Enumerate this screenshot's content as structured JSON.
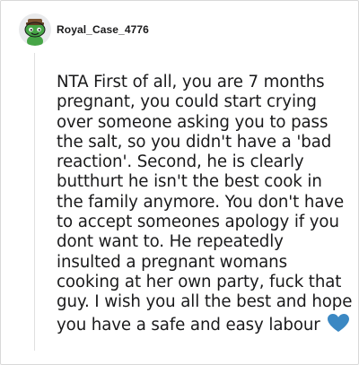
{
  "comment": {
    "author": "Royal_Case_4776",
    "avatar_icon": "reddit-snoo-avatar-icon",
    "body": "NTA First of all, you are 7 months pregnant, you could start crying over someone asking you to pass the salt, so you didn't have a 'bad reaction'. Second, he is clearly butthurt he isn't the best cook in the family anymore. You don't have to accept someones apology if you dont want to. He repeatedly insulted a pregnant womans cooking at her own party, fuck that guy. I wish you all the best and hope you have a safe and easy labour",
    "emoji_icon": "blue-heart-icon"
  },
  "colors": {
    "text": "#1a1a1b",
    "heart": "#3b88c3",
    "avatar_green": "#46a546",
    "avatar_bg": "#e9eaec"
  }
}
